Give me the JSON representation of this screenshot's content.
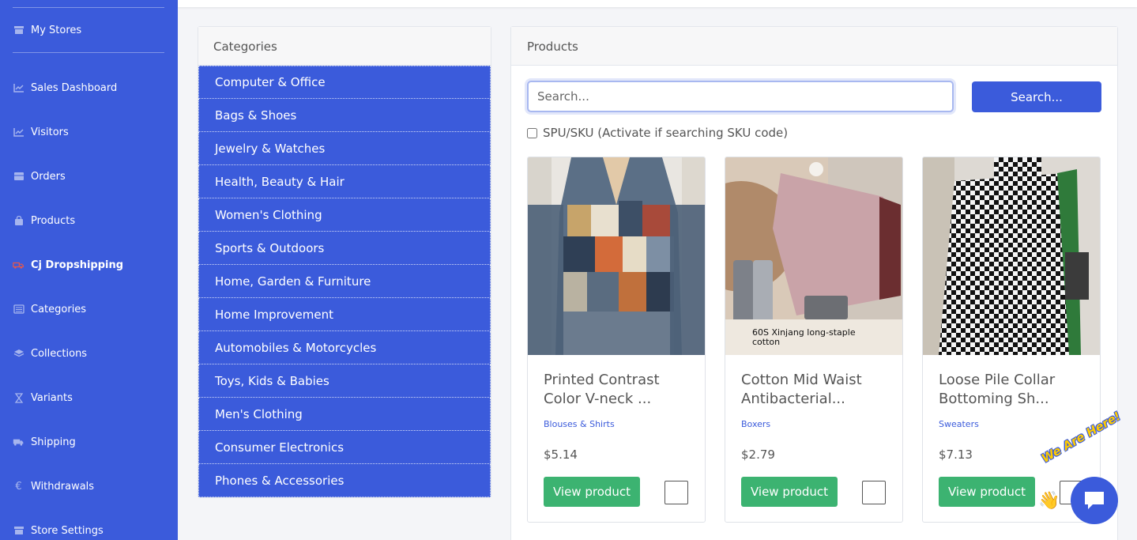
{
  "sidebar": {
    "items": [
      {
        "label": "My Stores",
        "icon": "store-icon"
      },
      {
        "label": "Sales Dashboard",
        "icon": "line-chart-icon"
      },
      {
        "label": "Visitors",
        "icon": "line-chart-icon"
      },
      {
        "label": "Orders",
        "icon": "box-icon"
      },
      {
        "label": "Products",
        "icon": "shopping-bag-icon"
      },
      {
        "label": "Cj Dropshipping",
        "icon": "truck-icon"
      },
      {
        "label": "Categories",
        "icon": "list-icon"
      },
      {
        "label": "Collections",
        "icon": "layers-icon"
      },
      {
        "label": "Variants",
        "icon": "hourglass-icon"
      },
      {
        "label": "Shipping",
        "icon": "shipping-icon"
      },
      {
        "label": "Withdrawals",
        "icon": "euro-icon"
      },
      {
        "label": "Store Settings",
        "icon": "store-icon"
      }
    ]
  },
  "categories_panel": {
    "title": "Categories",
    "items": [
      "Computer & Office",
      "Bags & Shoes",
      "Jewelry & Watches",
      "Health, Beauty & Hair",
      "Women's Clothing",
      "Sports & Outdoors",
      "Home, Garden & Furniture",
      "Home Improvement",
      "Automobiles & Motorcycles",
      "Toys, Kids & Babies",
      "Men's Clothing",
      "Consumer Electronics",
      "Phones & Accessories"
    ]
  },
  "products_panel": {
    "title": "Products",
    "search_placeholder": "Search...",
    "search_button": "Search...",
    "sku_label": "SPU/SKU (Activate if searching SKU code)",
    "products": [
      {
        "title": "Printed Contrast Color V-neck ...",
        "category": "Blouses & Shirts",
        "price": "$5.14",
        "view_label": "View product"
      },
      {
        "title": "Cotton Mid Waist Antibacterial...",
        "category": "Boxers",
        "price": "$2.79",
        "view_label": "View product",
        "image_caption": "60S Xinjang long-staple cotton"
      },
      {
        "title": "Loose Pile Collar Bottoming Sh...",
        "category": "Sweaters",
        "price": "$7.13",
        "view_label": "View product"
      }
    ]
  },
  "chat_widget": {
    "label": "We Are Here!"
  },
  "colors": {
    "brand": "#3b5bdb",
    "success": "#3cb371",
    "chat_label": "#ffcc00"
  }
}
